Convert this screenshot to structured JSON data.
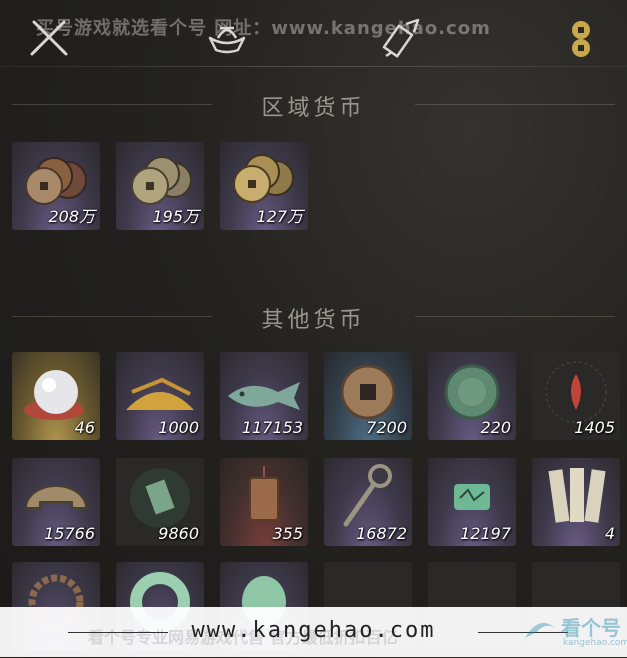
{
  "watermark_top": "买号游戏就选看个号   网址：www.kangehao.com",
  "tabs": [
    {
      "icon": "crossed-swords-icon",
      "active": false
    },
    {
      "icon": "ingot-icon",
      "active": false
    },
    {
      "icon": "scroll-icon",
      "active": false
    },
    {
      "icon": "coins-icon",
      "active": true
    }
  ],
  "sections": {
    "regional": {
      "title": "区域货币",
      "items": [
        {
          "icon": "coin-stack-icon",
          "count": "208万",
          "rarity": "purple"
        },
        {
          "icon": "coin-stack-icon",
          "count": "195万",
          "rarity": "purple"
        },
        {
          "icon": "coin-stack-icon",
          "count": "127万",
          "rarity": "purple"
        }
      ]
    },
    "other": {
      "title": "其他货币",
      "rows": [
        [
          {
            "icon": "pearl-icon",
            "count": "46",
            "rarity": "gold"
          },
          {
            "icon": "grain-pile-icon",
            "count": "1000",
            "rarity": "purple"
          },
          {
            "icon": "jade-fish-icon",
            "count": "117153",
            "rarity": "purple"
          },
          {
            "icon": "square-hole-coin-icon",
            "count": "7200",
            "rarity": "blue"
          },
          {
            "icon": "jade-disc-icon",
            "count": "220",
            "rarity": "purple"
          },
          {
            "icon": "red-flame-token-icon",
            "count": "1405",
            "rarity": "dark"
          }
        ],
        [
          {
            "icon": "half-coin-icon",
            "count": "15766",
            "rarity": "purple"
          },
          {
            "icon": "jade-tablet-icon",
            "count": "9860",
            "rarity": "dark"
          },
          {
            "icon": "bronze-plaque-icon",
            "count": "355",
            "rarity": "red"
          },
          {
            "icon": "key-sword-coin-icon",
            "count": "16872",
            "rarity": "purple"
          },
          {
            "icon": "jade-seal-icon",
            "count": "12197",
            "rarity": "purple"
          },
          {
            "icon": "paper-slips-icon",
            "count": "4",
            "rarity": "purple"
          }
        ],
        [
          {
            "icon": "bead-bracelet-icon",
            "count": "",
            "rarity": "purple"
          },
          {
            "icon": "jade-ring-icon",
            "count": "",
            "rarity": "purple"
          },
          {
            "icon": "jade-pendant-icon",
            "count": "",
            "rarity": "purple"
          },
          {
            "icon": "empty-slot-icon",
            "count": "",
            "rarity": "dark"
          },
          {
            "icon": "empty-slot-icon",
            "count": "",
            "rarity": "dark"
          },
          {
            "icon": "empty-slot-icon",
            "count": "",
            "rarity": "dark"
          }
        ]
      ]
    }
  },
  "bottom_watermark": {
    "url": "www.kangehao.com",
    "faded_text": "看个号专业网易游戏代售   官方最低折扣百亿",
    "logo_text": "看个号",
    "logo_sub": "kangehao.com"
  },
  "colors": {
    "accent_gold": "#c9a84a",
    "title_gray": "#9a968d"
  }
}
